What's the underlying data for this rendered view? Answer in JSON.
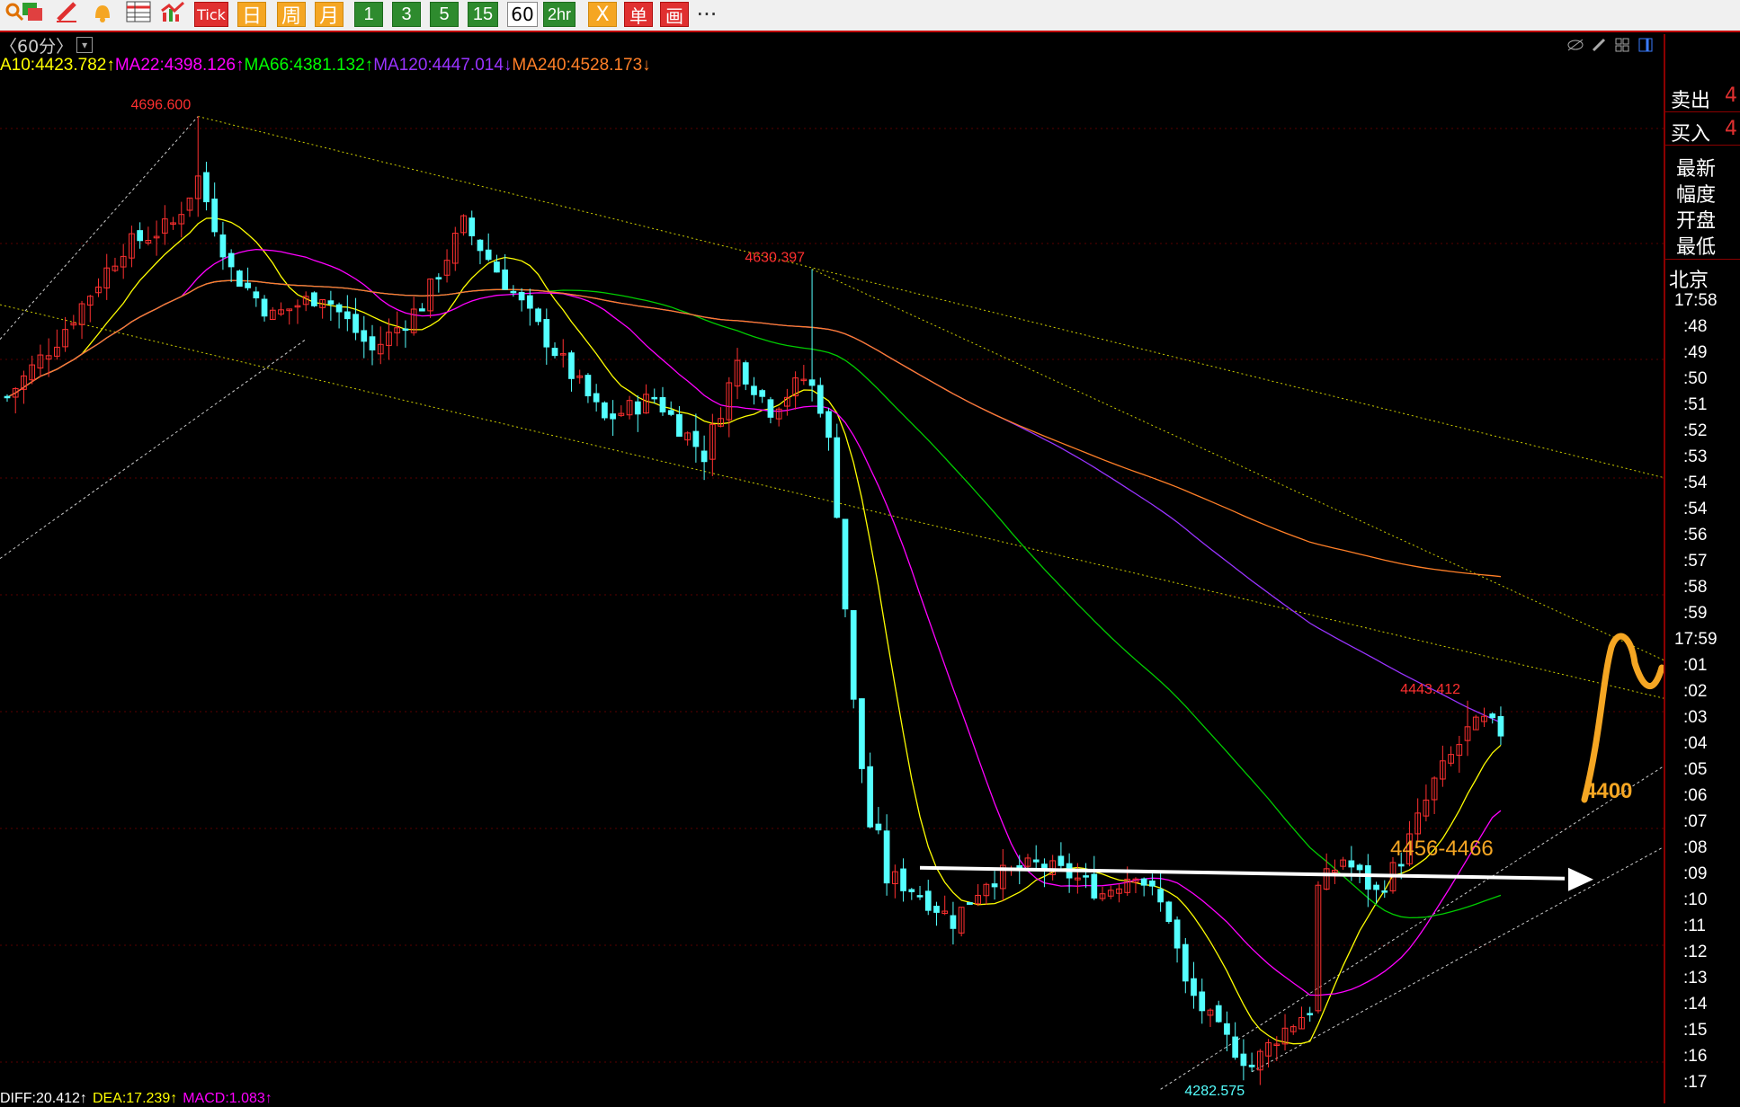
{
  "toolbar": {
    "buttons": [
      {
        "label": "",
        "icon": "magnifier-icon",
        "kind": "plain"
      },
      {
        "label": "",
        "icon": "windows-icon",
        "kind": "plain"
      },
      {
        "label": "",
        "icon": "pen-icon",
        "kind": "plain"
      },
      {
        "label": "",
        "icon": "bell-icon",
        "kind": "plain"
      },
      {
        "label": "",
        "icon": "table-icon",
        "kind": "plain"
      },
      {
        "label": "",
        "icon": "trend-icon",
        "kind": "plain"
      },
      {
        "label": "Tick",
        "icon": "",
        "kind": "red"
      },
      {
        "label": "日",
        "icon": "",
        "kind": "cn"
      },
      {
        "label": "周",
        "icon": "",
        "kind": "cn"
      },
      {
        "label": "月",
        "icon": "",
        "kind": "cn"
      },
      {
        "label": "1",
        "icon": "",
        "kind": "num"
      },
      {
        "label": "3",
        "icon": "",
        "kind": "num"
      },
      {
        "label": "5",
        "icon": "",
        "kind": "num"
      },
      {
        "label": "15",
        "icon": "",
        "kind": "num"
      },
      {
        "label": "60",
        "icon": "",
        "kind": "sel"
      },
      {
        "label": "2hr",
        "icon": "",
        "kind": "num"
      },
      {
        "label": "X",
        "icon": "",
        "kind": "cn"
      },
      {
        "label": "单",
        "icon": "",
        "kind": "red"
      },
      {
        "label": "画",
        "icon": "",
        "kind": "red"
      },
      {
        "label": "···",
        "icon": "",
        "kind": "plain"
      }
    ]
  },
  "period": {
    "label": "〈60分〉"
  },
  "ma_legend": [
    {
      "text": "A10:4423.782↑",
      "color": "#ffff00"
    },
    {
      "text": "MA22:4398.126↑",
      "color": "#ff00ff"
    },
    {
      "text": "MA66:4381.132↑",
      "color": "#00ff00"
    },
    {
      "text": "MA120:4447.014↓",
      "color": "#9933ff"
    },
    {
      "text": "MA240:4528.173↓",
      "color": "#ff7f27"
    }
  ],
  "macd_legend": [
    {
      "text": "DIFF:20.412↑",
      "color": "#ffffff"
    },
    {
      "text": "DEA:17.239↑",
      "color": "#ffff00"
    },
    {
      "text": "MACD:1.083↑",
      "color": "#ff00ff"
    }
  ],
  "right_panel": {
    "sell": {
      "label": "卖出",
      "value": "4"
    },
    "buy": {
      "label": "买入",
      "value": "4"
    },
    "fields": [
      "最新",
      "幅度",
      "开盘",
      "最低"
    ],
    "city": "北京",
    "times": [
      "17:58",
      ":48",
      ":49",
      ":50",
      ":51",
      ":52",
      ":53",
      ":54",
      ":54",
      ":56",
      ":57",
      ":58",
      ":59",
      "17:59",
      ":01",
      ":02",
      ":03",
      ":04",
      ":05",
      ":06",
      ":07",
      ":08",
      ":09",
      ":10",
      ":11",
      ":12",
      ":13",
      ":14",
      ":15",
      ":16",
      ":17"
    ]
  },
  "colors": {
    "up": "#ff3030",
    "down": "#54ffff",
    "ma10": "#ffff00",
    "ma22": "#ff00ff",
    "ma66": "#00cc00",
    "ma120": "#9933ff",
    "ma240": "#ff7f27",
    "annotation": "#f5a623",
    "grid": "#5a0000"
  },
  "chart_data": {
    "type": "candlestick",
    "price_range": [
      4272,
      4712
    ],
    "candles_approx_count": 190,
    "key_points": [
      {
        "label": "4696.600",
        "index": 23,
        "price": 4696.6
      },
      {
        "label": "4630.397",
        "index": 97,
        "price": 4630.397
      },
      {
        "label": "4282.575",
        "index": 150,
        "price": 4282.575
      },
      {
        "label": "4443.412",
        "index": 176,
        "price": 4443.412
      }
    ],
    "close_last": 4430,
    "annotations": [
      {
        "text": "4456-4466",
        "type": "resistance-label"
      },
      {
        "text": "4400",
        "type": "support-label"
      }
    ]
  }
}
